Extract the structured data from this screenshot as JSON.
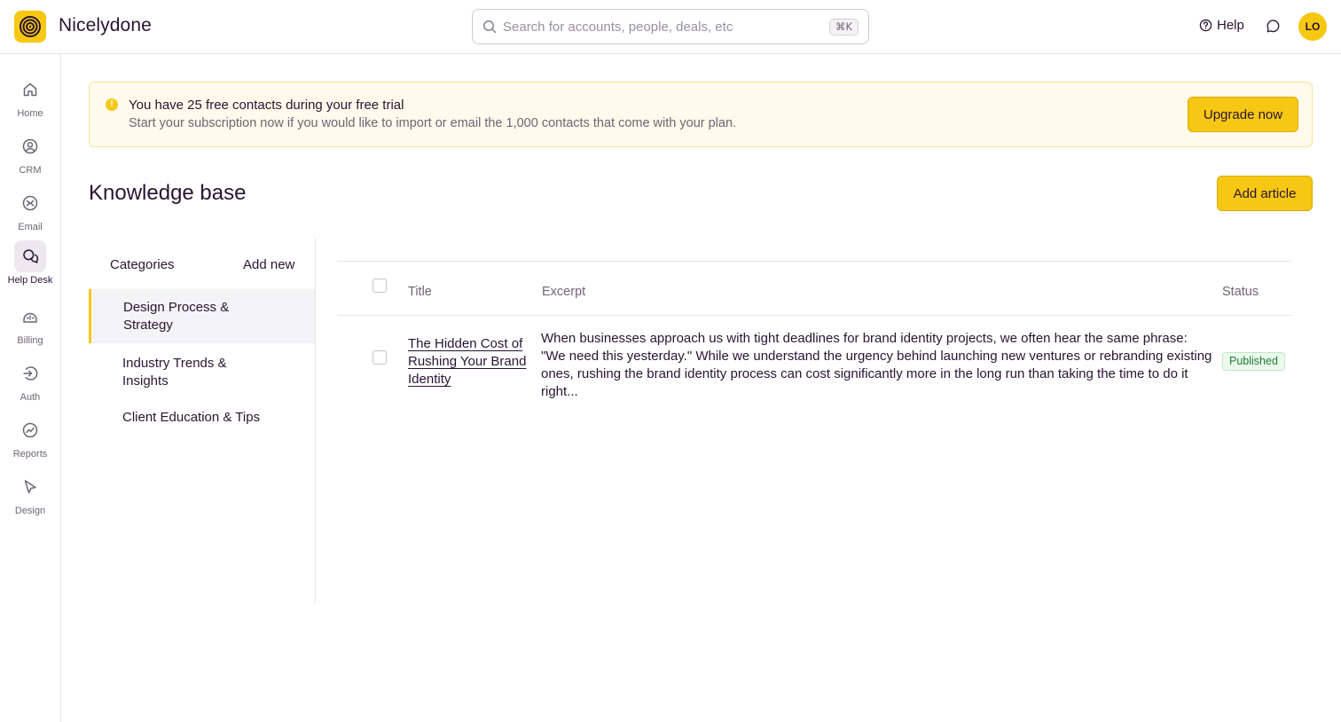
{
  "app": {
    "name": "Nicelydone",
    "logo_icon": "concentric-circles-logo"
  },
  "search": {
    "placeholder": "Search for accounts, people, deals, etc",
    "shortcut": "⌘K"
  },
  "header": {
    "help_label": "Help",
    "avatar_initials": "LO"
  },
  "sidebar": {
    "items": [
      {
        "label": "Home",
        "icon": "home-icon"
      },
      {
        "label": "CRM",
        "icon": "user-circle-icon"
      },
      {
        "label": "Email",
        "icon": "email-icon"
      },
      {
        "label": "Help Desk",
        "icon": "chat-bubbles-icon",
        "active": true
      },
      {
        "label": "Billing",
        "icon": "billing-icon"
      },
      {
        "label": "Auth",
        "icon": "auth-icon"
      },
      {
        "label": "Reports",
        "icon": "reports-icon"
      },
      {
        "label": "Design",
        "icon": "cursor-icon"
      }
    ]
  },
  "banner": {
    "title": "You have 25 free contacts during your free trial",
    "description": "Start your subscription now if you would like to import or email the 1,000 contacts that come with your plan.",
    "button_label": "Upgrade now"
  },
  "page": {
    "title": "Knowledge base",
    "add_button_label": "Add article"
  },
  "categories": {
    "heading": "Categories",
    "add_label": "Add new",
    "items": [
      {
        "label": "Design Process & Strategy",
        "active": true
      },
      {
        "label": "Industry Trends & Insights",
        "active": false
      },
      {
        "label": "Client Education & Tips",
        "active": false
      }
    ]
  },
  "table": {
    "columns": {
      "title": "Title",
      "excerpt": "Excerpt",
      "status": "Status"
    },
    "rows": [
      {
        "title": "The Hidden Cost of Rushing Your Brand Identity",
        "excerpt": "When businesses approach us with tight deadlines for brand identity projects, we often hear the same phrase: \"We need this yesterday.\" While we understand the urgency behind launching new ventures or rebranding existing ones, rushing the brand identity process can cost significantly more in the long run than taking the time to do it right...",
        "status": "Published"
      }
    ]
  },
  "colors": {
    "accent": "#f6c814",
    "text": "#2a1433",
    "muted": "#6f6477",
    "success": "#1e7a34"
  }
}
